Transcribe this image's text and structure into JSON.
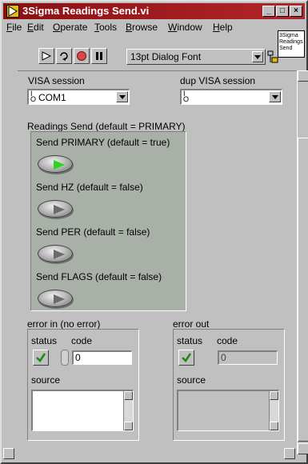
{
  "window": {
    "title": "3Sigma Readings Send.vi",
    "controls": {
      "minimize": "_",
      "maximize": "□",
      "close": "×"
    }
  },
  "menu": {
    "items": [
      {
        "label": "File",
        "mn": "F",
        "rest": "ile"
      },
      {
        "label": "Edit",
        "mn": "E",
        "rest": "dit"
      },
      {
        "label": "Operate",
        "mn": "O",
        "rest": "perate"
      },
      {
        "label": "Tools",
        "mn": "T",
        "rest": "ools"
      },
      {
        "label": "Browse",
        "mn": "B",
        "rest": "rowse"
      },
      {
        "label": "Window",
        "mn": "W",
        "rest": "indow"
      },
      {
        "label": "Help",
        "mn": "H",
        "rest": "elp"
      }
    ]
  },
  "vi_icon": {
    "line1": "3Sigma",
    "line2": "Readings",
    "line3": "Send"
  },
  "toolbar": {
    "icons": [
      "run-arrow-icon",
      "run-continuously-icon",
      "abort-icon",
      "pause-icon"
    ],
    "font": "13pt Dialog Font"
  },
  "controls": {
    "visa_label": "VISA session",
    "visa_value": "COM1",
    "dup_label": "dup VISA session",
    "dup_value": "",
    "cluster_label": "Readings Send (default = PRIMARY)",
    "send_primary": {
      "label": "Send PRIMARY (default = true)",
      "value": true
    },
    "send_hz": {
      "label": "Send HZ (default = false)",
      "value": false
    },
    "send_per": {
      "label": "Send PER (default = false)",
      "value": false
    },
    "send_flags": {
      "label": "Send FLAGS (default = false)",
      "value": false
    }
  },
  "error_in": {
    "label": "error in (no error)",
    "status_label": "status",
    "code_label": "code",
    "code_value": "0",
    "source_label": "source",
    "status_icon": "green-check-icon"
  },
  "error_out": {
    "label": "error out",
    "status_label": "status",
    "code_label": "code",
    "code_value": "0",
    "source_label": "source",
    "status_icon": "green-check-icon"
  }
}
